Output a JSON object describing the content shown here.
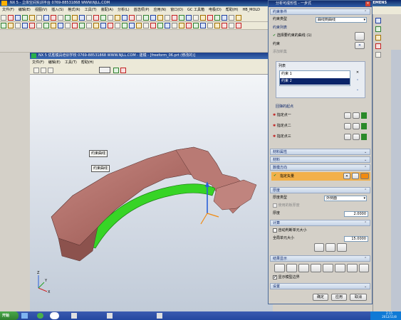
{
  "main_window": {
    "title": "NX 5 - 立体空间实训平台  0769-88531868  WWW.NJLL.COM",
    "brand": "SIEMENS",
    "menu": [
      "文件(F)",
      "编辑(E)",
      "视图(V)",
      "插入(S)",
      "格式(R)",
      "工具(T)",
      "装配(A)",
      "分析(L)",
      "首选项(P)",
      "应用(N)",
      "窗口(O)",
      "GC 工具箱",
      "电极(D)",
      "帮助(H)",
      "HB_MOLD"
    ]
  },
  "graphics_window": {
    "title": "NX 5  优胜模具培训学校  0769-88531868  WWW.NJLL.COM  - 建模 - [freeform_06.prt (修改的)]",
    "menu": [
      "文件(F)",
      "编辑(E)",
      "工具(T)",
      "帮助(H)"
    ],
    "labels": {
      "curve_label_1": "约束曲线",
      "curve_label_2": "约束曲线"
    },
    "triad": {
      "x": "X",
      "y": "Y",
      "z": "Z"
    }
  },
  "dialog": {
    "title": "分析可成形性 - 一步式",
    "close_glyph": "×",
    "sections": {
      "constraints": "约束条件",
      "material": "材料属性",
      "materials": "材料",
      "direction": "数模方向",
      "thickness": "厚度",
      "compute": "计算",
      "display": "结果显示",
      "settings": "设置"
    },
    "constraint_type_label": "约束类型",
    "constraint_type_value": "曲线到曲线",
    "constraint_list_label": "约束列表",
    "select_object": "选择要约束的曲线 (1)",
    "item_prefix": "约束",
    "add_new": "添加新集",
    "list_label": "列表",
    "list_items": [
      "约束 1",
      "约束 2"
    ],
    "point_group": "回弹的起点",
    "points": [
      "指定点一",
      "指定点二",
      "指定点三"
    ],
    "direction_label": "指定矢量",
    "thickness_type_label": "厚度类型",
    "thickness_type_value": "外侧面",
    "use_pressure": "使用的板厚度",
    "thickness_label": "厚度",
    "thickness_value": "2.0000",
    "auto_cell": "自动判断单元大小",
    "global_size_label": "全局单元大小",
    "global_size_value": "15.0000",
    "show_boundary": "显示模型边界",
    "ok": "确定",
    "apply": "应用",
    "cancel": "取消"
  },
  "taskbar": {
    "start": "开始",
    "time": "2:15",
    "date": "2012/11/8"
  },
  "colors": {
    "titlebar": "#0a246a",
    "part_surface": "#b87570",
    "selected_curve": "#37d426",
    "dialog_bg": "#d4d0c8"
  }
}
